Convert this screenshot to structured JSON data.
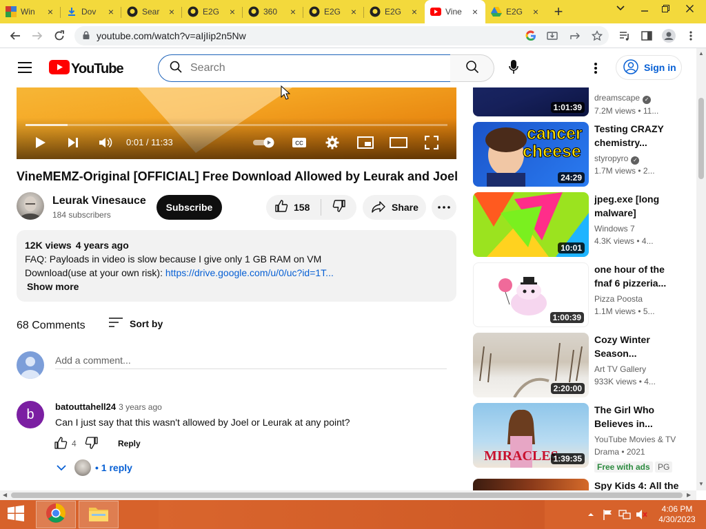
{
  "browser": {
    "tabs": [
      {
        "label": "Win",
        "icon": "mixed-grid-icon"
      },
      {
        "label": "Dov",
        "icon": "download-icon"
      },
      {
        "label": "Sear",
        "icon": "github-icon"
      },
      {
        "label": "E2G",
        "icon": "github-icon"
      },
      {
        "label": "360",
        "icon": "github-icon"
      },
      {
        "label": "E2G",
        "icon": "github-icon"
      },
      {
        "label": "E2G",
        "icon": "github-icon"
      },
      {
        "label": "Vine",
        "icon": "youtube-icon"
      },
      {
        "label": "E2G",
        "icon": "google-drive-icon"
      }
    ],
    "url": "youtube.com/watch?v=aIjIip2n5Nw"
  },
  "youtube": {
    "logo_text": "YouTube",
    "search_placeholder": "Search",
    "signin_label": "Sign in"
  },
  "player": {
    "time": "0:01 / 11:33",
    "progress": 0.1
  },
  "video": {
    "title": "VineMEMZ-Original [OFFICIAL] Free Download Allowed by Leurak and Joel",
    "channel": "Leurak Vinesauce",
    "subscribers": "184 subscribers",
    "subscribe_label": "Subscribe",
    "likes": "158",
    "share_label": "Share"
  },
  "description": {
    "views": "12K views",
    "age": "4 years ago",
    "line1": "FAQ: Payloads in video is slow because I give only 1 GB RAM on VM",
    "line2_prefix": "Download(use at your own risk): ",
    "line2_link": "https://drive.google.com/u/0/uc?id=1T...",
    "show_more": "Show more"
  },
  "comments": {
    "count": "68 Comments",
    "sort_label": "Sort by",
    "add_placeholder": "Add a comment...",
    "items": [
      {
        "avatar_letter": "b",
        "author": "batouttahell24",
        "time": "3 years ago",
        "text": "Can I just say that this wasn't allowed by Joel or Leurak at any point?",
        "likes": "4",
        "reply_label": "Reply",
        "replies_label": "1 reply"
      }
    ]
  },
  "recommendations": [
    {
      "title": "",
      "channel": "dreamscape",
      "verified": true,
      "views": "7.2M views • 11...",
      "duration": "1:01:39"
    },
    {
      "title": "Testing CRAZY chemistry...",
      "channel": "styropyro",
      "verified": true,
      "views": "1.7M views • 2...",
      "duration": "24:29",
      "thumb_text_1": "cancer",
      "thumb_text_2": "cheese"
    },
    {
      "title": "jpeg.exe [long malware]",
      "channel": "Windows 7",
      "verified": false,
      "views": "4.3K views • 4...",
      "duration": "10:01"
    },
    {
      "title": "one hour of the fnaf 6 pizzeria...",
      "channel": "Pizza Poosta",
      "verified": false,
      "views": "1.1M views • 5...",
      "duration": "1:00:39"
    },
    {
      "title": "Cozy Winter Season...",
      "channel": "Art TV Gallery",
      "verified": false,
      "views": "933K views • 4...",
      "duration": "2:20:00"
    },
    {
      "title": "The Girl Who Believes in...",
      "channel": "YouTube Movies & TV",
      "verified": false,
      "views": "Drama • 2021",
      "duration": "1:39:35",
      "thumb_text_1": "MIRACLES"
    },
    {
      "title": "Spy Kids 4: All the",
      "channel": "",
      "verified": false,
      "views": "",
      "duration": ""
    }
  ],
  "movie_badges": {
    "free": "Free with ads",
    "rating": "PG"
  },
  "taskbar": {
    "time": "4:06 PM",
    "date": "4/30/2023"
  },
  "colors": {
    "tabstrip": "#f3d93c",
    "youtube_red": "#ff0000",
    "link": "#065fd4",
    "taskbar": "#d7622b"
  }
}
